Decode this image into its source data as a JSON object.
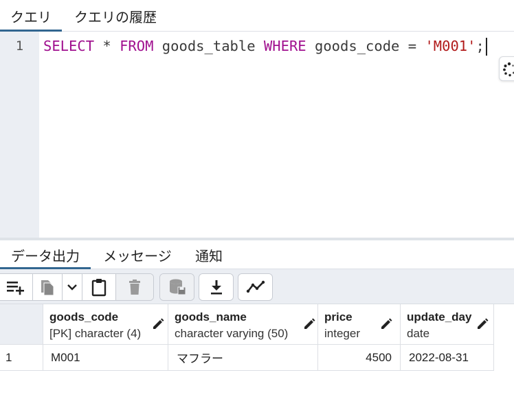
{
  "top_tabs": [
    {
      "label": "クエリ",
      "active": true
    },
    {
      "label": "クエリの履歴",
      "active": false
    }
  ],
  "editor": {
    "line_number": "1",
    "tokens": [
      {
        "text": "SELECT",
        "kind": "keyword"
      },
      {
        "text": " * ",
        "kind": "plain"
      },
      {
        "text": "FROM",
        "kind": "keyword"
      },
      {
        "text": " goods_table ",
        "kind": "plain"
      },
      {
        "text": "WHERE",
        "kind": "keyword"
      },
      {
        "text": " goods_code = ",
        "kind": "plain"
      },
      {
        "text": "'M001'",
        "kind": "string"
      },
      {
        "text": ";",
        "kind": "plain"
      }
    ]
  },
  "bottom_tabs": [
    {
      "label": "データ出力",
      "active": true
    },
    {
      "label": "メッセージ",
      "active": false
    },
    {
      "label": "通知",
      "active": false
    }
  ],
  "toolbar": {
    "icons": [
      "add-row-icon",
      "copy-icon",
      "chevron-down-icon",
      "paste-icon",
      "delete-icon",
      "save-data-icon",
      "download-icon",
      "graph-icon"
    ]
  },
  "grid": {
    "columns": [
      {
        "name": "goods_code",
        "type": "[PK] character (4)"
      },
      {
        "name": "goods_name",
        "type": "character varying (50)"
      },
      {
        "name": "price",
        "type": "integer"
      },
      {
        "name": "update_day",
        "type": "date"
      }
    ],
    "rows": [
      {
        "row_number": "1",
        "cells": [
          "M001",
          "マフラー",
          "4500",
          "2022-08-31"
        ]
      }
    ]
  },
  "colors": {
    "accent": "#326690",
    "keyword": "#a0108f",
    "string": "#b11a1a",
    "gutter": "#ebeef3"
  }
}
